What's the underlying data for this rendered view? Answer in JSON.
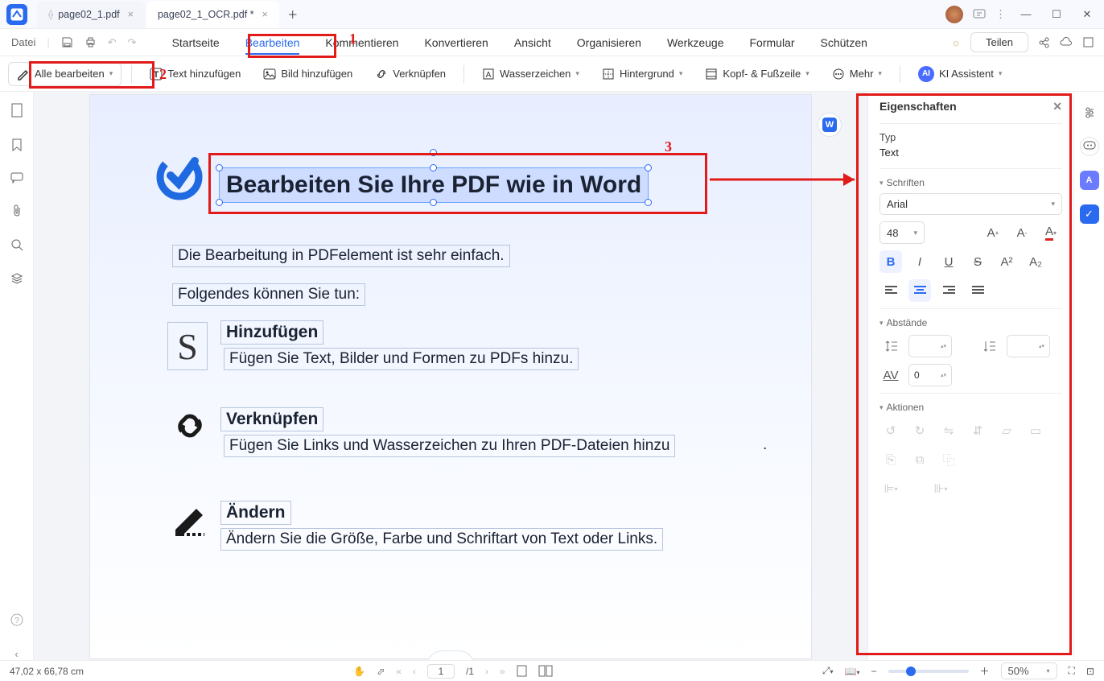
{
  "tabs": {
    "t1": "page02_1.pdf",
    "t2": "page02_1_OCR.pdf *"
  },
  "row2": {
    "datei": "Datei",
    "menu": [
      "Startseite",
      "Bearbeiten",
      "Kommentieren",
      "Konvertieren",
      "Ansicht",
      "Organisieren",
      "Werkzeuge",
      "Formular",
      "Schützen"
    ],
    "teilen": "Teilen"
  },
  "toolbar": {
    "alle": "Alle bearbeiten",
    "text": "Text hinzufügen",
    "bild": "Bild hinzufügen",
    "link": "Verknüpfen",
    "wz": "Wasserzeichen",
    "bg": "Hintergrund",
    "hf": "Kopf- & Fußzeile",
    "mehr": "Mehr",
    "ki": "KI Assistent"
  },
  "annots": {
    "n1": "1",
    "n2": "2",
    "n3": "3"
  },
  "doc": {
    "headline": "Bearbeiten Sie Ihre PDF wie in Word",
    "p1": "Die Bearbeitung in PDFelement ist sehr einfach.",
    "p2": "Folgendes können Sie tun:",
    "h1": "Hinzufügen",
    "d1": "Fügen Sie Text, Bilder und Formen zu PDFs hinzu.",
    "h2": "Verknüpfen",
    "d2": "Fügen Sie Links und Wasserzeichen zu Ihren PDF-Dateien hinzu",
    "dot": ".",
    "h3": "Ändern",
    "d3": "Ändern Sie die Größe, Farbe und Schriftart von Text oder Links."
  },
  "panel": {
    "title": "Eigenschaften",
    "typ_label": "Typ",
    "typ_value": "Text",
    "schriften": "Schriften",
    "font": "Arial",
    "size": "48",
    "abst": "Abstände",
    "spacing_left": "",
    "spacing_right": "",
    "charspace": "0",
    "aktionen": "Aktionen"
  },
  "status": {
    "dims": "47,02 x 66,78 cm",
    "page_current": "1",
    "page_total": "/1",
    "zoom": "50%"
  }
}
